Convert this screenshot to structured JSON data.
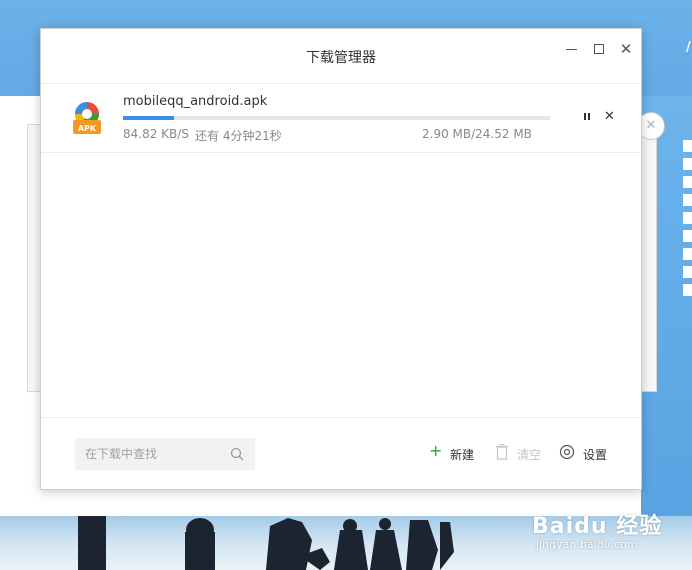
{
  "window": {
    "title": "下载管理器"
  },
  "download": {
    "filename": "mobileqq_android.apk",
    "icon": "apk-icon",
    "icon_label": "APK",
    "speed": "84.82 KB/S",
    "remaining": "还有 4分钟21秒",
    "size": "2.90 MB/24.52 MB",
    "progress": 0.12,
    "accent": "#3b8ee6"
  },
  "footer": {
    "search_placeholder": "在下载中查找",
    "new_label": "新建",
    "clear_label": "清空",
    "settings_label": "设置"
  },
  "watermark": {
    "logo": "Baidu 经验",
    "url": "jingyan.baidu.com"
  },
  "colors": {
    "sky": "#6cb1ea",
    "new_icon": "#2da042",
    "disabled": "#c4c4c4"
  }
}
